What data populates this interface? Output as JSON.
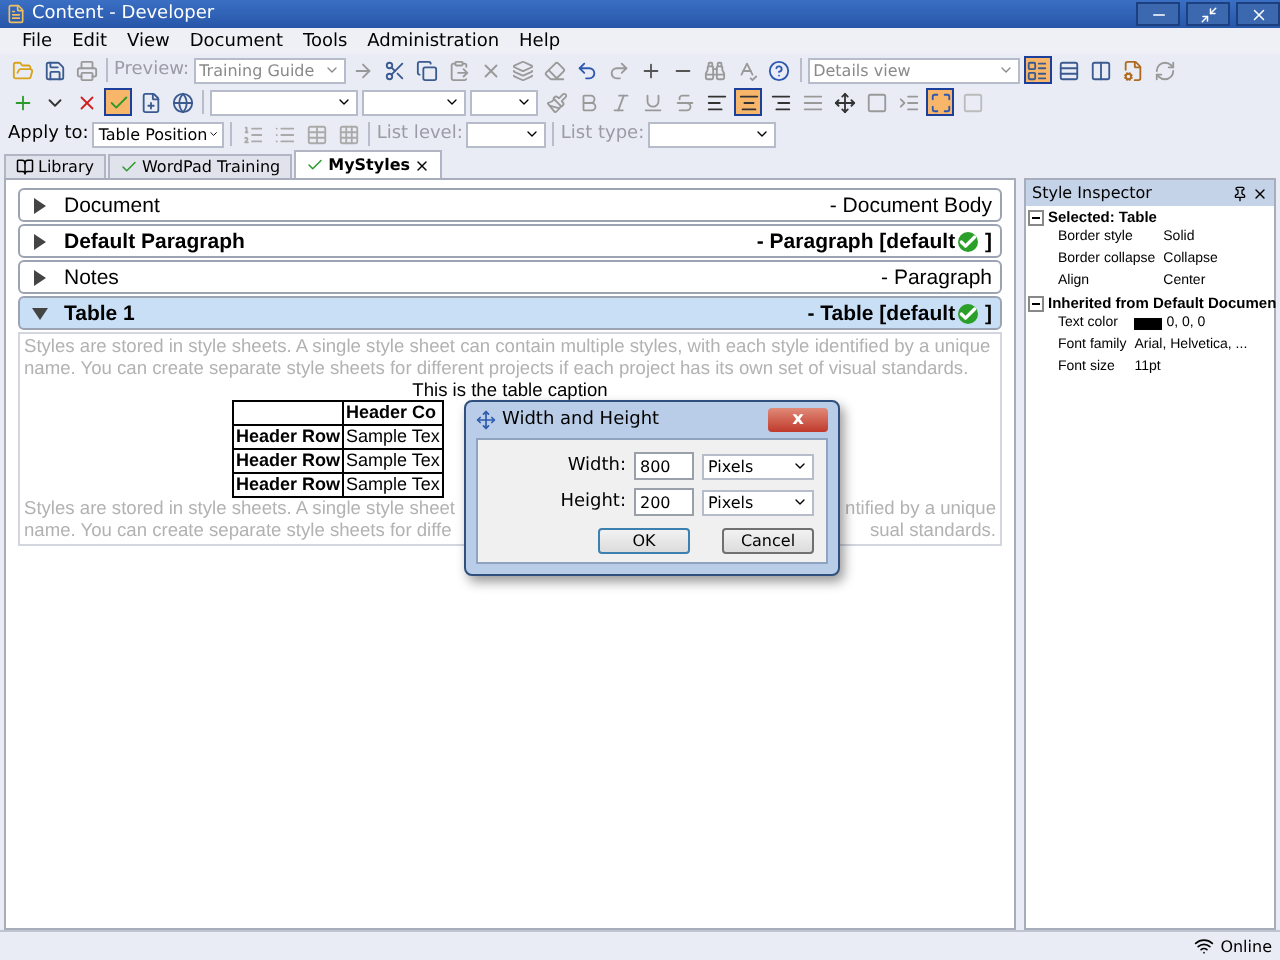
{
  "window": {
    "title": "Content - Developer"
  },
  "menu": [
    "File",
    "Edit",
    "View",
    "Document",
    "Tools",
    "Administration",
    "Help"
  ],
  "toolbar_1": {
    "buttons_left": [
      {
        "pressed": false
      },
      {
        "pressed": false
      },
      {
        "pressed": false
      }
    ],
    "preview_label": "Preview:",
    "preview_value": "Training Guide",
    "buttons_mid": [
      {
        "pressed": false
      },
      {
        "pressed": false
      },
      {
        "pressed": false
      },
      {
        "pressed": false
      },
      {
        "pressed": false
      },
      {
        "pressed": false
      },
      {
        "pressed": false
      },
      {
        "pressed": false
      },
      {
        "pressed": false
      },
      {
        "pressed": false
      },
      {
        "pressed": false
      },
      {
        "pressed": false
      },
      {
        "pressed": false
      }
    ],
    "view_value": "Details view",
    "buttons_right": [
      {
        "pressed": true
      },
      {
        "pressed": false
      },
      {
        "pressed": false
      },
      {
        "pressed": false
      },
      {
        "pressed": false
      }
    ]
  },
  "toolbar_2": {
    "buttons_left": [
      {
        "pressed": false
      },
      {
        "pressed": false
      },
      {
        "pressed": false
      },
      {
        "pressed": true
      },
      {
        "pressed": false
      }
    ],
    "buttons_right": [
      {
        "pressed": false
      },
      {
        "pressed": false
      },
      {
        "pressed": false
      },
      {
        "pressed": false
      },
      {
        "pressed": false
      },
      {
        "pressed": false
      },
      {
        "pressed": true
      },
      {
        "pressed": false
      },
      {
        "pressed": false
      },
      {
        "pressed": false
      },
      {
        "pressed": false
      },
      {
        "pressed": false
      },
      {
        "pressed": true
      },
      {
        "pressed": false
      }
    ]
  },
  "toolbar_3": {
    "apply_to_label": "Apply to:",
    "apply_to_value": "Table Position",
    "list_level_label": "List level:",
    "list_type_label": "List type:"
  },
  "tabs": [
    {
      "label": "Library",
      "selected": false
    },
    {
      "label": "WordPad Training",
      "selected": false
    },
    {
      "label": "MyStyles",
      "selected": true
    }
  ],
  "styles": [
    {
      "name": "Document",
      "type": "- Document Body",
      "bold": false,
      "expanded": false,
      "default": false
    },
    {
      "name": "Default Paragraph",
      "type": "- Paragraph [default",
      "type_end": "]",
      "bold": true,
      "expanded": false,
      "default": true
    },
    {
      "name": "Notes",
      "type": "- Paragraph",
      "bold": false,
      "expanded": false,
      "default": false
    },
    {
      "name": "Table 1",
      "type": "- Table [default",
      "type_end": "]",
      "bold": true,
      "expanded": true,
      "default": true
    }
  ],
  "preview": {
    "paragraph": "Styles are stored in style sheets. A single style sheet can contain multiple styles, with each style identified by a unique name. You can create separate style sheets for different projects if each project has its own set of visual standards.",
    "caption": "This is the table caption",
    "header": [
      "Header Co"
    ],
    "rows": [
      [
        "Header Row",
        "Sample Tex"
      ],
      [
        "Header Row",
        "Sample Tex"
      ],
      [
        "Header Row",
        "Sample Tex"
      ]
    ],
    "lines_after": [
      {
        "left": "Styles are stored in style sheets. A single style sheet",
        "right": "ntified by a unique"
      },
      {
        "left": "name. You can create separate style sheets for diffe",
        "right": "sual standards."
      }
    ]
  },
  "dialog": {
    "title": "Width and Height",
    "close": "x",
    "fields": [
      {
        "label": "Width:",
        "value": "800",
        "unit": "Pixels"
      },
      {
        "label": "Height:",
        "value": "200",
        "unit": "Pixels"
      }
    ],
    "buttons": [
      "OK",
      "Cancel"
    ]
  },
  "inspector": {
    "title": "Style Inspector",
    "groups": [
      {
        "title": "Selected: Table",
        "expanded": true,
        "props": [
          {
            "name": "Border style",
            "value": "Solid"
          },
          {
            "name": "Border collapse",
            "value": "Collapse"
          },
          {
            "name": "Align",
            "value": "Center"
          }
        ]
      },
      {
        "title": "Inherited from Default Documen",
        "expanded": true,
        "props": [
          {
            "name": "Text color",
            "value": "0, 0, 0",
            "color": "#000000"
          },
          {
            "name": "Font family",
            "value": "Arial, Helvetica, ..."
          },
          {
            "name": "Font size",
            "value": "11pt"
          }
        ]
      }
    ]
  },
  "status": "Online"
}
